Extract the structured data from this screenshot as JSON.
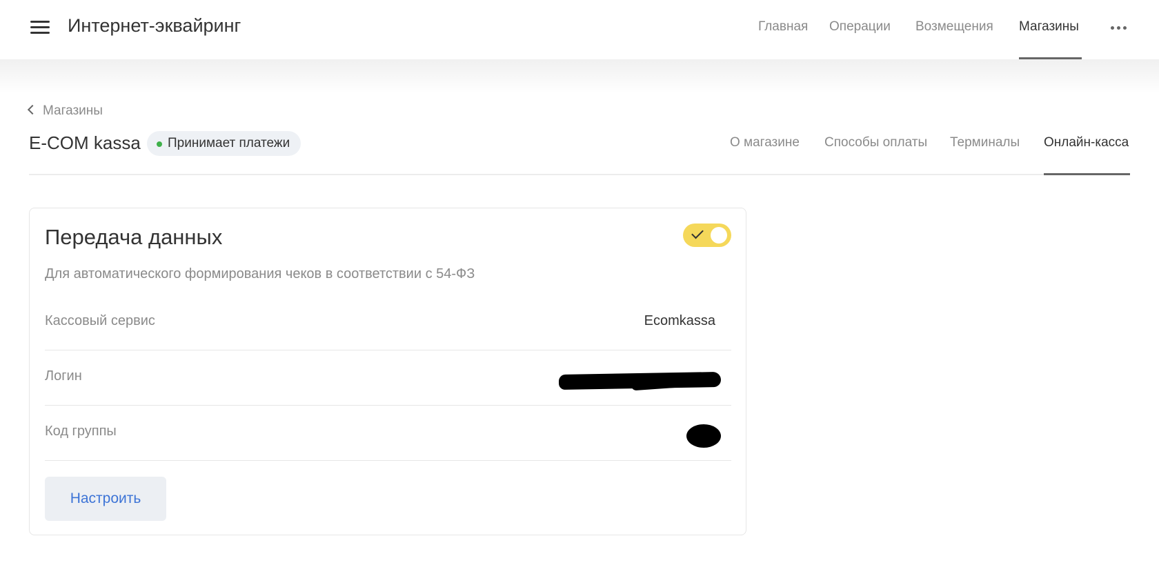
{
  "header": {
    "app_title": "Интернет-эквайринг",
    "nav": [
      {
        "label": "Главная"
      },
      {
        "label": "Операции"
      },
      {
        "label": "Возмещения"
      },
      {
        "label": "Магазины",
        "active": true
      }
    ],
    "menu_icon": "hamburger-icon",
    "more_icon": "more-horizontal-icon"
  },
  "breadcrumb": {
    "back_label": "Магазины",
    "icon": "chevron-left-icon"
  },
  "shop": {
    "name": "E-COM kassa",
    "status": "Принимает платежи",
    "status_color": "#3fb04a"
  },
  "subnav": [
    {
      "label": "О магазине"
    },
    {
      "label": "Способы оплаты"
    },
    {
      "label": "Терминалы"
    },
    {
      "label": "Онлайн-касса",
      "active": true
    }
  ],
  "card": {
    "title": "Передача данных",
    "toggle_on": true,
    "toggle_color": "#f5d85a",
    "description": "Для автоматического формирования чеков в соответствии с 54-ФЗ",
    "rows": [
      {
        "label": "Кассовый сервис",
        "value": "Ecomkassa"
      },
      {
        "label": "Логин",
        "value": ""
      },
      {
        "label": "Код группы",
        "value": ""
      }
    ],
    "button_label": "Настроить"
  },
  "colors": {
    "accent_link": "#3d74d6",
    "active_underline": "#666666"
  }
}
